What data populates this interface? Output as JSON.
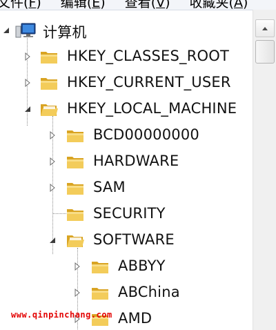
{
  "menubar": {
    "items": [
      {
        "text": "文件",
        "hotkey": "F"
      },
      {
        "text": "编辑",
        "hotkey": "E"
      },
      {
        "text": "查看",
        "hotkey": "V"
      },
      {
        "text": "收藏夹",
        "hotkey": "A"
      }
    ]
  },
  "tree": {
    "root": {
      "label": "计算机",
      "icon": "computer-icon",
      "expanded": true
    },
    "hives": [
      {
        "label": "HKEY_CLASSES_ROOT",
        "expanded": false
      },
      {
        "label": "HKEY_CURRENT_USER",
        "expanded": false
      },
      {
        "label": "HKEY_LOCAL_MACHINE",
        "expanded": true
      }
    ],
    "hklm_children": [
      {
        "label": "BCD00000000",
        "expanded": false
      },
      {
        "label": "HARDWARE",
        "expanded": false
      },
      {
        "label": "SAM",
        "expanded": false
      },
      {
        "label": "SECURITY",
        "leaf": true
      },
      {
        "label": "SOFTWARE",
        "expanded": true
      }
    ],
    "software_children": [
      {
        "label": "ABBYY",
        "expanded": false
      },
      {
        "label": "ABChina",
        "expanded": false
      },
      {
        "label": "AMD",
        "expanded": false
      }
    ]
  },
  "watermark": "www.qinpinchang.com",
  "colors": {
    "folder": "#e8b93c",
    "tree_text": "#111111",
    "watermark": "#e30000"
  }
}
